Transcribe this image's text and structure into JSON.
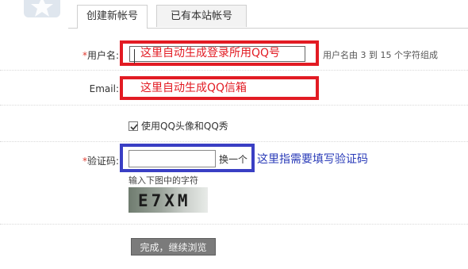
{
  "tabs": [
    {
      "label": "创建新帐号",
      "active": true
    },
    {
      "label": "已有本站帐号",
      "active": false
    }
  ],
  "form": {
    "username": {
      "label": "用户名:",
      "required_mark": "*",
      "annotation": "这里自动生成登录所用QQ号",
      "hint": "用户名由 3 到 15 个字符组成"
    },
    "email": {
      "label": "Email:",
      "annotation": "这里自动生成QQ信箱"
    },
    "use_qq_avatar": {
      "label": "使用QQ头像和QQ秀",
      "checked": true
    },
    "captcha": {
      "label": "验证码:",
      "required_mark": "*",
      "value": "",
      "refresh_label": "换一个",
      "annotation": "这里指需要填写验证码",
      "image_hint": "输入下图中的字符",
      "image_text": "E7XM"
    },
    "submit_label": "完成，继续浏览"
  },
  "colors": {
    "annotation_red": "#e21b23",
    "annotation_blue": "#3a3fc4",
    "required": "#e03c31",
    "button_bg": "#7b7b7b"
  }
}
